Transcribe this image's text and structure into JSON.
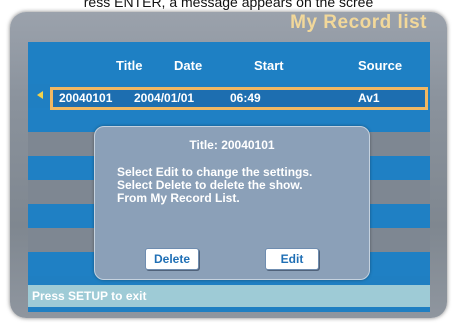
{
  "caption": "ress ENTER, a message appears on the scree",
  "app_title": "My Record list",
  "columns": [
    "Title",
    "Date",
    "Start",
    "Source"
  ],
  "selected_row": {
    "title": "20040101",
    "date": "2004/01/01",
    "start": "06:49",
    "source": "Av1"
  },
  "dialog": {
    "title": "Title: 20040101",
    "message_lines": [
      "Select Edit to change the settings.",
      "Select Delete to delete the show.",
      "From My Record List."
    ],
    "delete_label": "Delete",
    "edit_label": "Edit"
  },
  "footer": "Press SETUP to exit",
  "colors": {
    "screen_blue": "#1f7fc2",
    "stripe_gray": "#7e8792",
    "highlight_border": "#f2b863",
    "title_gold": "#f2d89a",
    "footer_bg": "#9ecbd6",
    "dialog_bg": "#8ba0b8"
  }
}
